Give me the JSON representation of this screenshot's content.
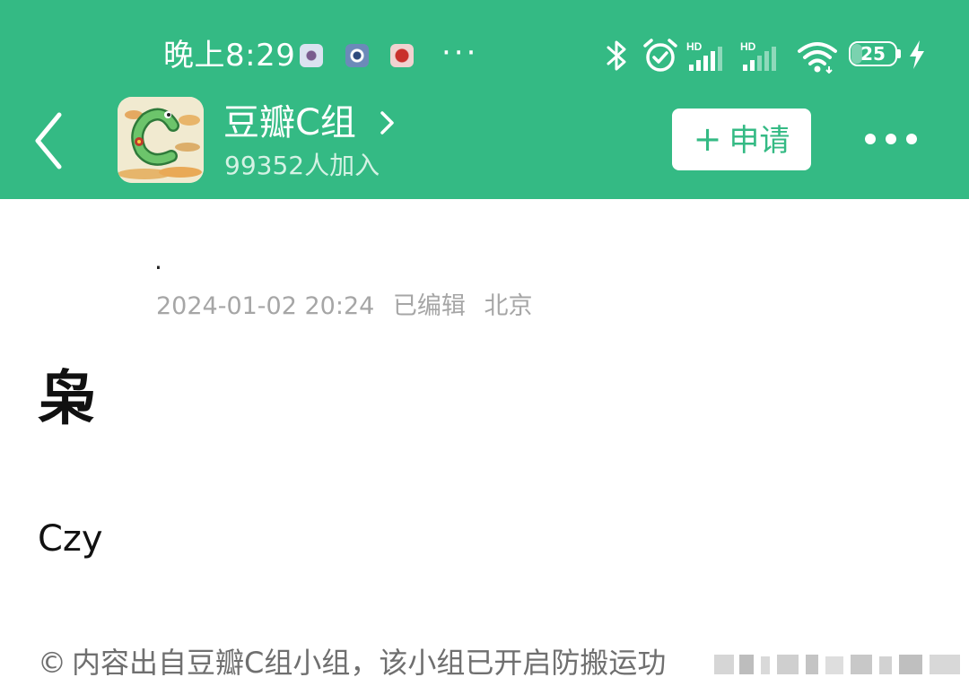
{
  "status_bar": {
    "time": "晚上8:29",
    "overflow": "···",
    "signal_label": "HD",
    "battery": "25",
    "battery_level": 0.25
  },
  "group_bar": {
    "name": "豆瓣C组",
    "members": "99352人加入",
    "apply_icon": "+",
    "apply_label": "申请"
  },
  "post": {
    "author": ".",
    "date": "2024-01-02 20:24",
    "edited": "已编辑",
    "location": "北京",
    "title": "枭",
    "body": "Czy"
  },
  "footer": {
    "copyright_symbol": "©",
    "notice": "内容出自豆瓣C组小组，该小组已开启防搬运功"
  },
  "colors": {
    "header_bg": "#34ba84",
    "meta_text": "#a6a6a6"
  },
  "icons": [
    "back-icon",
    "chevron-right-icon",
    "more-icon",
    "bluetooth-icon",
    "alarm-icon",
    "signal-icon",
    "wifi-icon",
    "battery-icon",
    "charging-icon"
  ]
}
